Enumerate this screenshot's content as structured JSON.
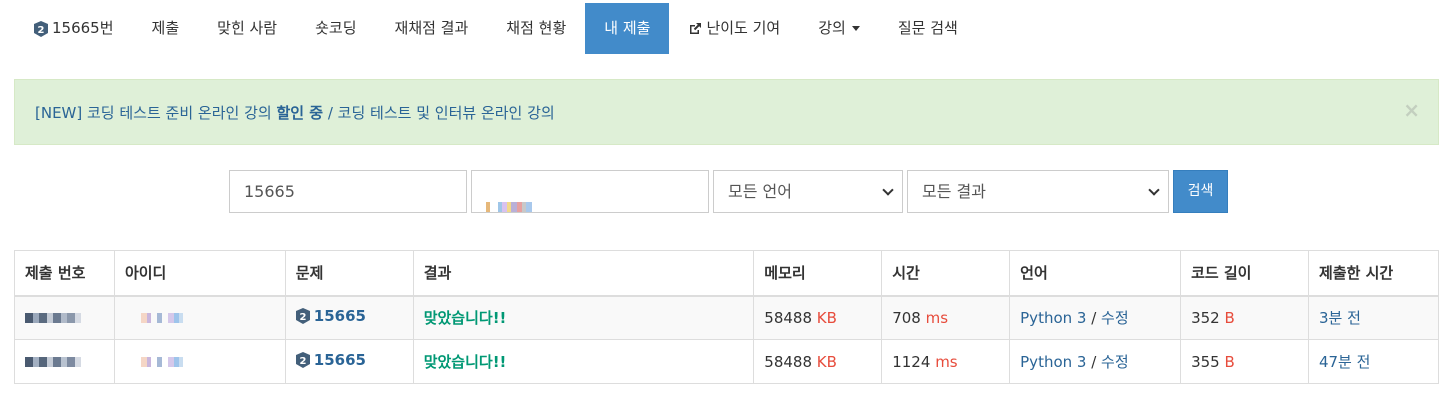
{
  "nav": {
    "problem_label": "15665번",
    "items": [
      "제출",
      "맞힌 사람",
      "숏코딩",
      "재채점 결과",
      "채점 현황",
      "내 제출",
      "난이도 기여",
      "강의",
      "질문 검색"
    ],
    "active": "내 제출"
  },
  "alert": {
    "part1": "[NEW] 코딩 테스트 준비 온라인 강의 ",
    "part2": "할인 중",
    "part3": " / 코딩 테스트 및 인터뷰 온라인 강의",
    "close": "×"
  },
  "search": {
    "problem_value": "15665",
    "language_selected": "모든 언어",
    "result_selected": "모든 결과",
    "button": "검색"
  },
  "table": {
    "headers": [
      "제출 번호",
      "아이디",
      "문제",
      "결과",
      "메모리",
      "시간",
      "언어",
      "코드 길이",
      "제출한 시간"
    ],
    "rows": [
      {
        "problem": "15665",
        "result": "맞았습니다!!",
        "memory": "58488",
        "memory_unit": "KB",
        "time": "708",
        "time_unit": "ms",
        "language": "Python 3",
        "sep": " / ",
        "edit": "수정",
        "code_len": "352",
        "code_unit": "B",
        "submitted": "3분 전"
      },
      {
        "problem": "15665",
        "result": "맞았습니다!!",
        "memory": "58488",
        "memory_unit": "KB",
        "time": "1124",
        "time_unit": "ms",
        "language": "Python 3",
        "sep": " / ",
        "edit": "수정",
        "code_len": "355",
        "code_unit": "B",
        "submitted": "47분 전"
      }
    ]
  },
  "colors": {
    "primary": "#428bca",
    "success_text": "#009874",
    "unit_red": "#e74c3c",
    "link": "#2a6496",
    "alert_bg": "#dff0d8"
  }
}
